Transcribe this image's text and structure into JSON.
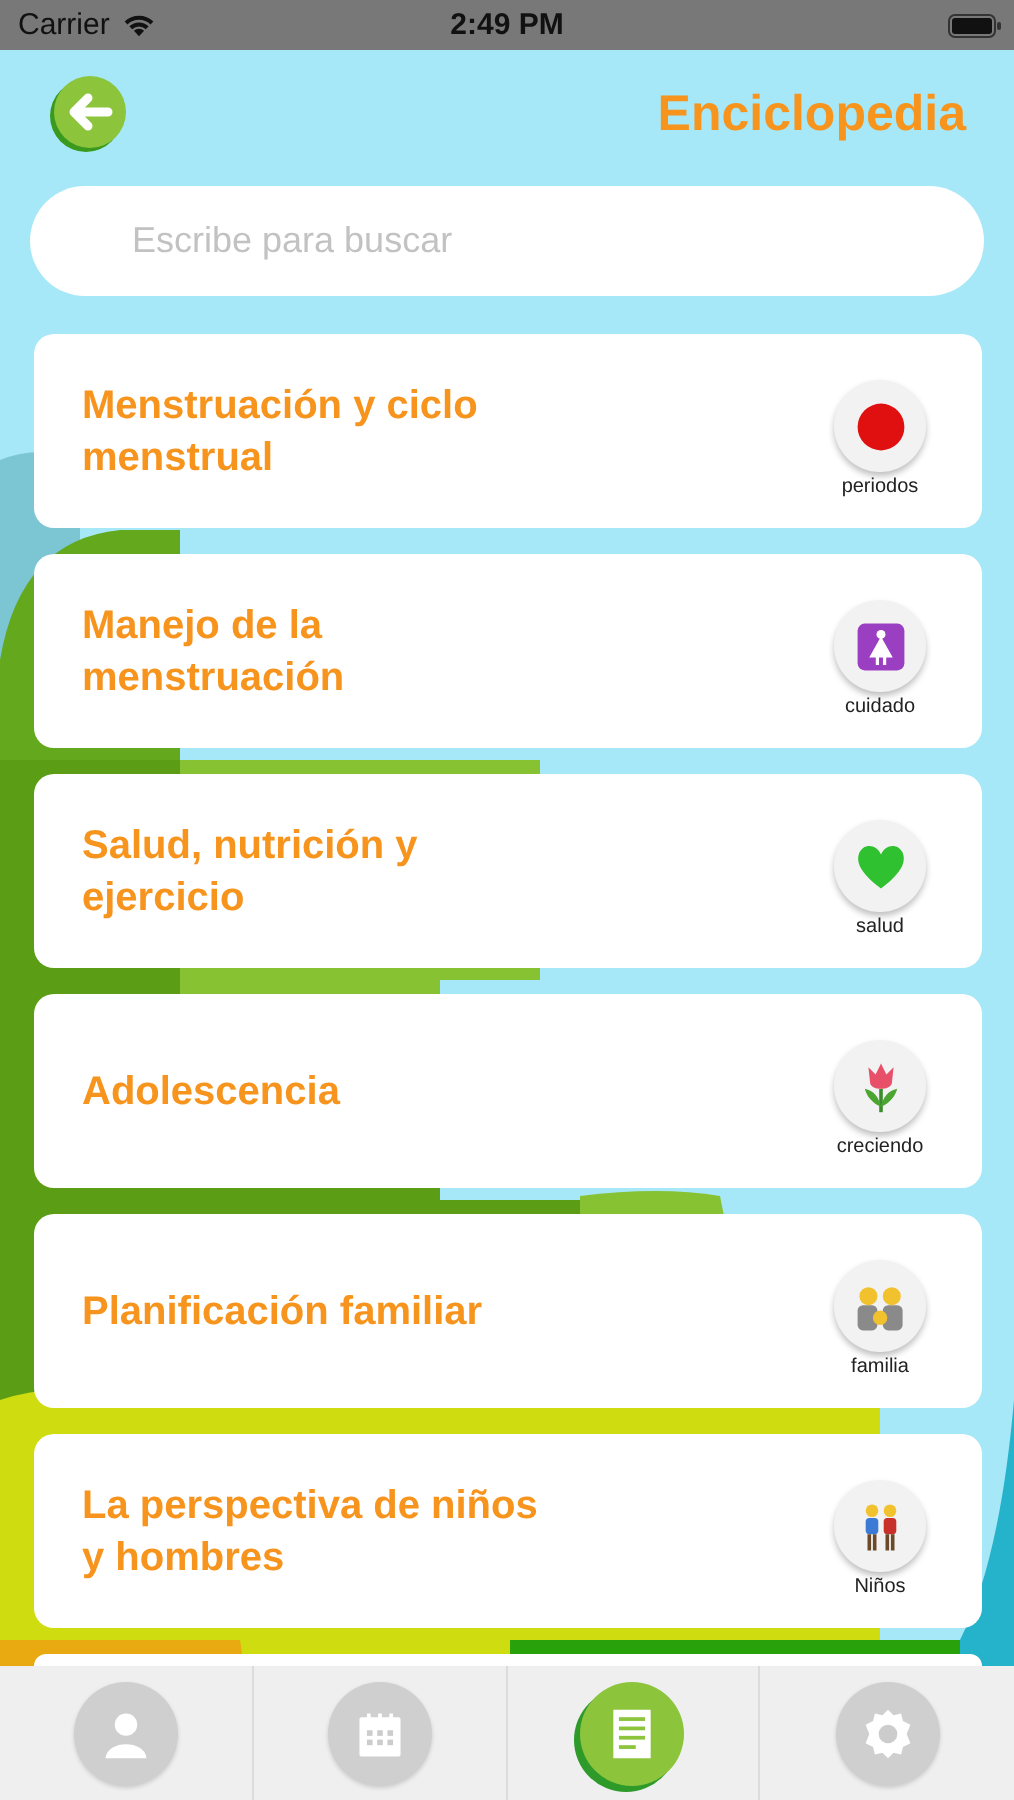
{
  "status_bar": {
    "carrier": "Carrier",
    "time": "2:49 PM"
  },
  "header": {
    "title": "Enciclopedia"
  },
  "search": {
    "placeholder": "Escribe para buscar"
  },
  "topics": [
    {
      "title": "Menstruación y ciclo menstrual",
      "label": "periodos"
    },
    {
      "title": "Manejo de la menstruación",
      "label": "cuidado"
    },
    {
      "title": "Salud, nutrición y ejercicio",
      "label": "salud"
    },
    {
      "title": "Adolescencia",
      "label": "creciendo"
    },
    {
      "title": "Planificación familiar",
      "label": "familia"
    },
    {
      "title": "La perspectiva de niños y hombres",
      "label": "Niños"
    }
  ],
  "tab_bar": [
    {
      "kind": "profile",
      "selected": false
    },
    {
      "kind": "calendar",
      "selected": false
    },
    {
      "kind": "encyclopedia",
      "selected": true
    },
    {
      "kind": "settings",
      "selected": false
    }
  ]
}
